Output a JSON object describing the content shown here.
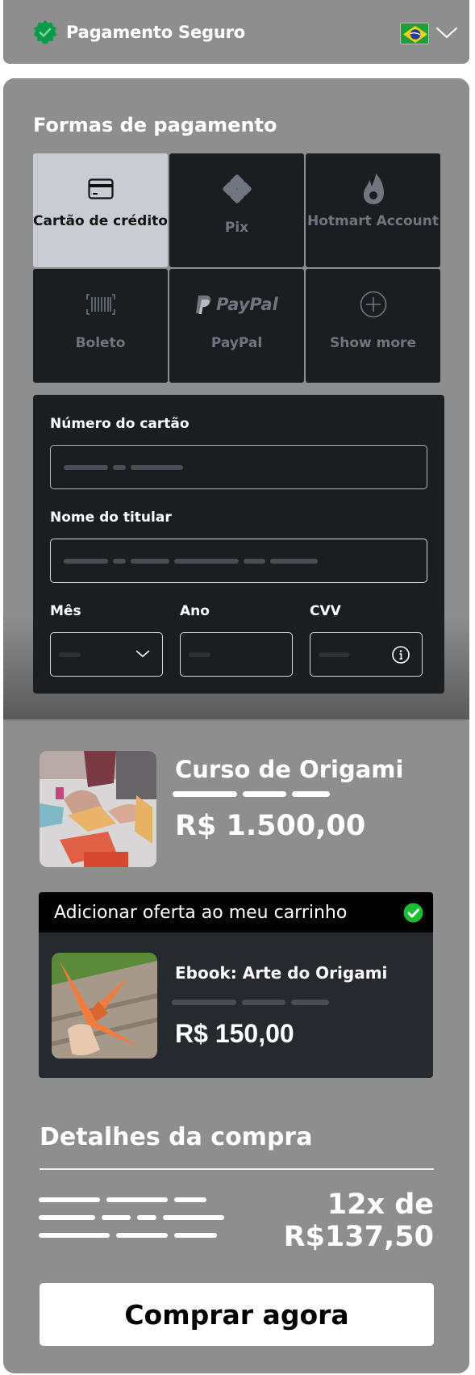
{
  "header": {
    "title": "Pagamento Seguro",
    "secure_icon": "verified-badge-icon",
    "country_flag": "brazil-flag",
    "country_selector_icon": "chevron-down-icon"
  },
  "payment_methods": {
    "title": "Formas de pagamento",
    "items": [
      {
        "label": "Cartão de crédito",
        "icon": "credit-card-icon",
        "active": true
      },
      {
        "label": "Pix",
        "icon": "pix-icon",
        "active": false
      },
      {
        "label": "Hotmart Account",
        "icon": "hotmart-flame-icon",
        "active": false
      },
      {
        "label": "Boleto",
        "icon": "barcode-icon",
        "active": false
      },
      {
        "label": "PayPal",
        "icon": "paypal-logo-icon",
        "logo_text": "PayPal",
        "active": false
      },
      {
        "label": "Show more",
        "icon": "plus-circle-icon",
        "active": false
      }
    ]
  },
  "card_form": {
    "card_number_label": "Número do cartão",
    "holder_name_label": "Nome do titular",
    "month_label": "Mês",
    "year_label": "Ano",
    "cvv_label": "CVV",
    "month_icon": "chevron-down-icon",
    "cvv_icon": "info-icon"
  },
  "product": {
    "title": "Curso de Origami",
    "price": "R$ 1.500,00",
    "image": "origami-hands-photo"
  },
  "offer": {
    "header": "Adicionar oferta ao meu carrinho",
    "checked": true,
    "title": "Ebook: Arte do Origami",
    "price": "R$ 150,00",
    "image": "orange-paper-crane-photo"
  },
  "details": {
    "title": "Detalhes da compra",
    "installments_line1": "12x de",
    "installments_line2": "R$137,50"
  },
  "buy_button": {
    "label": "Comprar agora"
  },
  "colors": {
    "panel": "#8e8e8e",
    "dark": "#1b1e21",
    "active_method": "#c9cdd3",
    "secure_green": "#0a9b46",
    "check_green": "#1dbd32"
  }
}
